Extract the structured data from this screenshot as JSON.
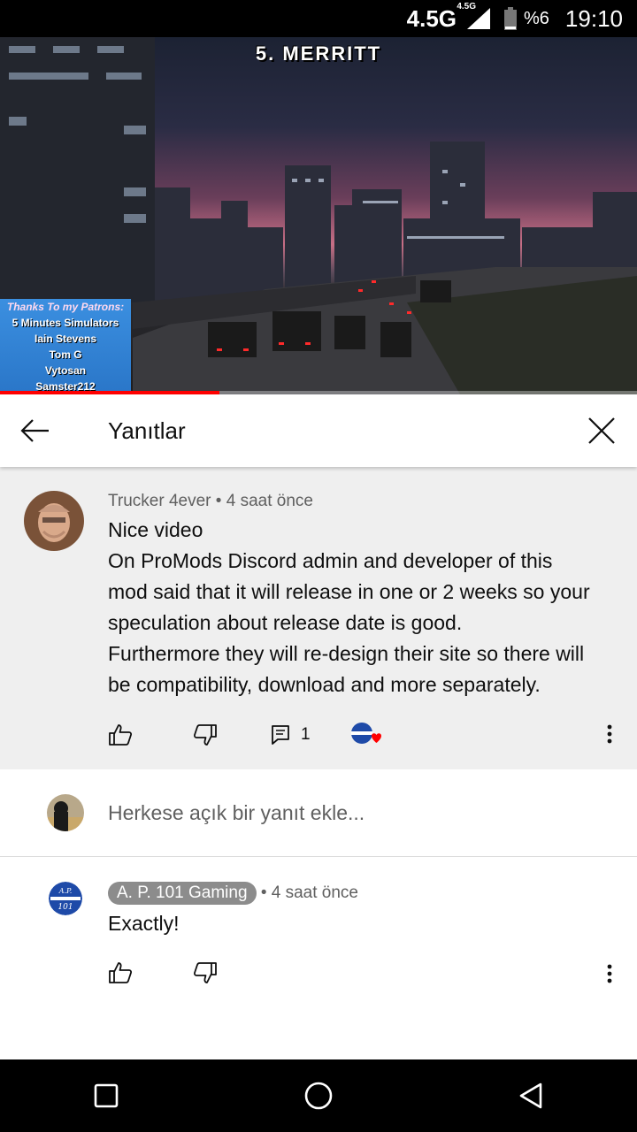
{
  "status_bar": {
    "network": "4.5G",
    "network_small": "4.5G",
    "battery_percent": "%6",
    "time": "19:10"
  },
  "video": {
    "title": "5. MERRITT",
    "patrons": {
      "heading": "Thanks To my Patrons:",
      "names": [
        "5 Minutes Simulators",
        "Iain Stevens",
        "Tom G",
        "Vytosan",
        "Samster212"
      ]
    },
    "progress_fraction": 0.345,
    "accent": "#ff0000"
  },
  "header": {
    "title": "Yanıtlar",
    "back_icon": "arrow-back-icon",
    "close_icon": "close-icon"
  },
  "main_comment": {
    "author": "Trucker 4ever",
    "separator": "•",
    "time": "4 saat önce",
    "lines": [
      "Nice video",
      "On ProMods Discord admin and developer of this",
      "mod said that it will release in one or 2 weeks so your",
      "speculation about release date is good.",
      "Furthermore they will re-design their site so there will",
      "be compatibility, download and more separately."
    ],
    "reply_count": "1",
    "creator_heart_badge": "A.P. 101"
  },
  "reply_input": {
    "placeholder": "Herkese açık bir yanıt ekle..."
  },
  "reply": {
    "author": "A. P. 101 Gaming",
    "separator": "•",
    "time": "4 saat önce",
    "text": "Exactly!",
    "avatar_text_top": "A.P.",
    "avatar_text_bottom": "101"
  },
  "nav": {
    "items": [
      "recent-apps",
      "home",
      "back"
    ]
  }
}
